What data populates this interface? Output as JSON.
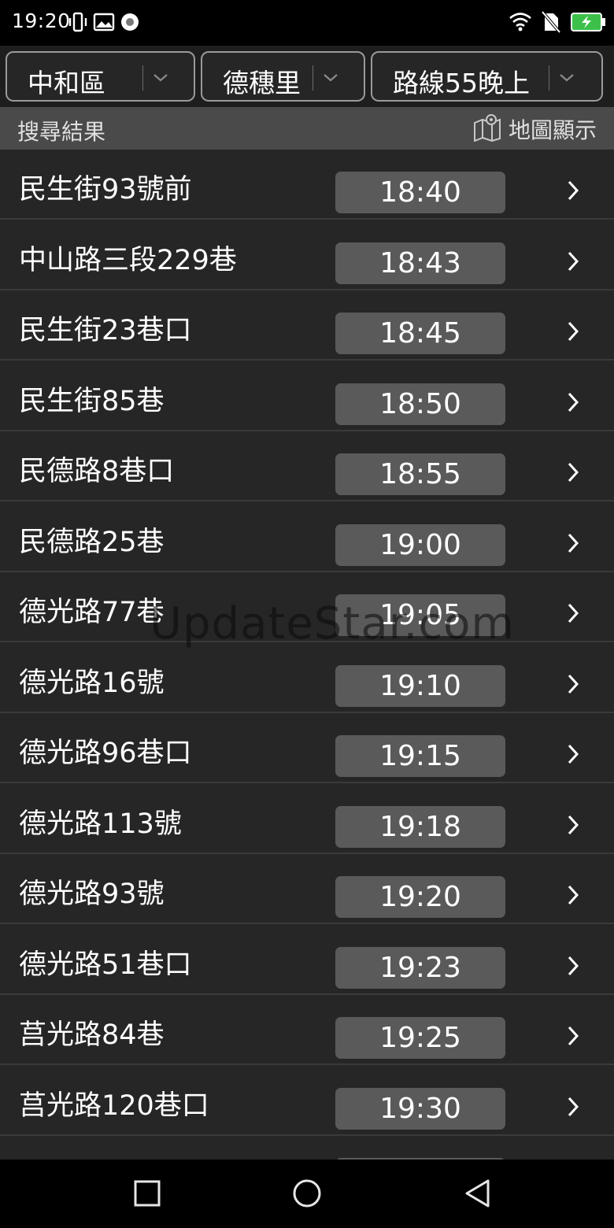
{
  "status_bar": {
    "time": "19:20",
    "icons_left": [
      "vibrate-icon",
      "image-icon",
      "record-icon"
    ],
    "icons_right": [
      "wifi-icon",
      "no-sim-icon",
      "battery-charging-icon"
    ]
  },
  "filters": {
    "district": "中和區",
    "village": "德穗里",
    "route": "路線55晚上"
  },
  "results": {
    "title": "搜尋結果",
    "map_label": "地圖顯示"
  },
  "stops": [
    {
      "name": "民生街93號前",
      "time": "18:40"
    },
    {
      "name": "中山路三段229巷",
      "time": "18:43"
    },
    {
      "name": "民生街23巷口",
      "time": "18:45"
    },
    {
      "name": "民生街85巷",
      "time": "18:50"
    },
    {
      "name": "民德路8巷口",
      "time": "18:55"
    },
    {
      "name": "民德路25巷",
      "time": "19:00"
    },
    {
      "name": "德光路77巷",
      "time": "19:05"
    },
    {
      "name": "德光路16號",
      "time": "19:10"
    },
    {
      "name": "德光路96巷口",
      "time": "19:15"
    },
    {
      "name": "德光路113號",
      "time": "19:18"
    },
    {
      "name": "德光路93號",
      "time": "19:20"
    },
    {
      "name": "德光路51巷口",
      "time": "19:23"
    },
    {
      "name": "莒光路84巷",
      "time": "19:25"
    },
    {
      "name": "莒光路120巷口",
      "time": "19:30"
    },
    {
      "name": "",
      "time": ""
    }
  ],
  "watermark": "UpdateStar.com",
  "colors": {
    "list_bg": "#262626",
    "time_pill": "#5a5a5a",
    "header_bg": "#4a4a4a"
  }
}
